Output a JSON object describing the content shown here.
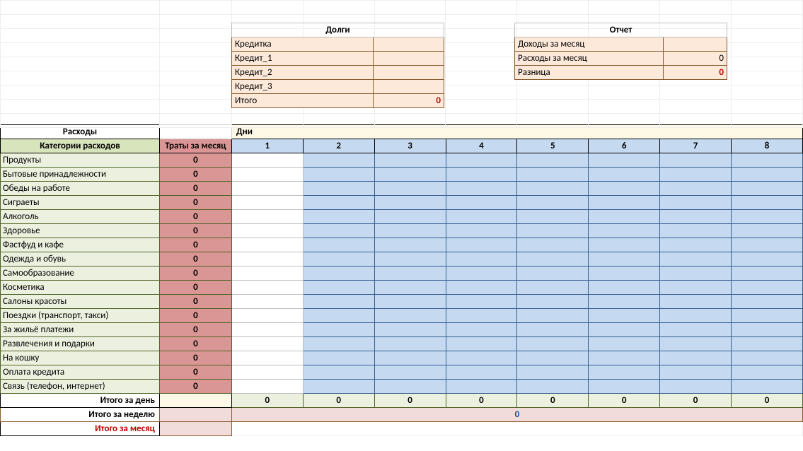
{
  "dolgi": {
    "title": "Долги",
    "rows": [
      {
        "label": "Кредитка",
        "value": ""
      },
      {
        "label": "Кредит_1",
        "value": ""
      },
      {
        "label": "Кредит_2",
        "value": ""
      },
      {
        "label": "Кредит_3",
        "value": ""
      }
    ],
    "total_label": "Итого",
    "total_value": "0"
  },
  "otchet": {
    "title": "Отчет",
    "rows": [
      {
        "label": "Доходы за месяц",
        "value": ""
      },
      {
        "label": "Расходы за месяц",
        "value": "0"
      },
      {
        "label": "Разница",
        "value": "0",
        "red": true
      }
    ]
  },
  "expenses": {
    "section_title": "Расходы",
    "cat_header": "Категории расходов",
    "month_header": "Траты за месяц",
    "days_header": "Дни",
    "days": [
      "1",
      "2",
      "3",
      "4",
      "5",
      "6",
      "7",
      "8"
    ],
    "categories": [
      "Продукты",
      "Бытовые принадлежности",
      "Обеды на работе",
      "Сиграеты",
      "Алкоголь",
      "Здоровье",
      "Фастфуд и кафе",
      "Одежда и обувь",
      "Самообразование",
      "Косметика",
      "Салоны красоты",
      "Поездки (транспорт, такси)",
      "За жильё платежи",
      "Развлечения и подарки",
      "На кошку",
      "Оплата кредита",
      "Связь (телефон, интернет)"
    ],
    "month_values": [
      "0",
      "0",
      "0",
      "0",
      "0",
      "0",
      "0",
      "0",
      "0",
      "0",
      "0",
      "0",
      "0",
      "0",
      "0",
      "0",
      "0"
    ],
    "footer_day_label": "Итого за день",
    "footer_day_values": [
      "0",
      "0",
      "0",
      "0",
      "0",
      "0",
      "0",
      "0"
    ],
    "footer_week_label": "Итого за неделю",
    "footer_week_value": "0",
    "footer_month_label": "Итого за месяц"
  }
}
